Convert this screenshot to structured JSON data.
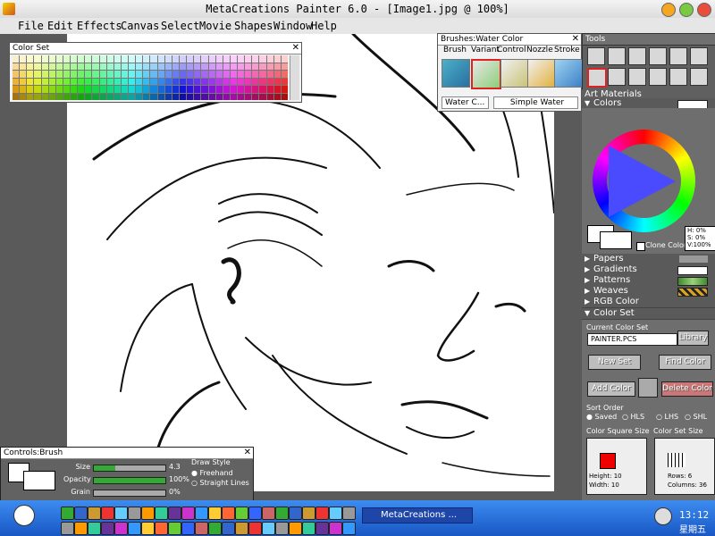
{
  "window": {
    "title": "MetaCreations Painter 6.0 - [Image1.jpg @ 100%]"
  },
  "menu": [
    "File",
    "Edit",
    "Effects",
    "Canvas",
    "Select",
    "Movie",
    "Shapes",
    "Window",
    "Help"
  ],
  "color_set_panel": {
    "title": "Color Set"
  },
  "brushes_panel": {
    "title": "Brushes:Water Color",
    "tabs": [
      "Brush",
      "Variant",
      "Control",
      "Nozzle",
      "Stroke"
    ],
    "category": "Water C...",
    "variant": "Simple Water"
  },
  "tools_panel": {
    "title": "Tools"
  },
  "art_materials": {
    "title": "Art Materials",
    "sections": [
      "Colors",
      "Papers",
      "Gradients",
      "Patterns",
      "Weaves",
      "RGB Color",
      "Color Set"
    ],
    "hsv": {
      "h": "H:  0%",
      "s": "S:  0%",
      "v": "V:100%"
    },
    "clone_color": "Clone Color",
    "current_color_set_label": "Current Color Set",
    "current_color_set_value": "PAINTER.PCS",
    "buttons": {
      "library": "Library",
      "new_set": "New Set",
      "find_color": "Find Color",
      "add_color": "Add Color",
      "delete_color": "Delete Color"
    },
    "sort_order_label": "Sort Order",
    "sort_options": [
      "Saved",
      "HLS",
      "LHS",
      "SHL"
    ],
    "color_square_size": {
      "label": "Color Square Size",
      "height": "Height: 10",
      "width": "Width: 10"
    },
    "color_set_size": {
      "label": "Color Set Size",
      "rows": "Rows: 6",
      "columns": "Columns: 36"
    }
  },
  "controls_panel": {
    "title": "Controls:Brush",
    "sliders": [
      {
        "label": "Size",
        "value": "4.3",
        "level": 0.3
      },
      {
        "label": "Opacity",
        "value": "100%",
        "level": 1.0
      },
      {
        "label": "Grain",
        "value": "0%",
        "level": 0.0
      }
    ],
    "draw_style": {
      "label": "Draw Style",
      "options": [
        "Freehand",
        "Straight Lines"
      ],
      "selected": "Freehand"
    }
  },
  "taskbar": {
    "task": "MetaCreations ...",
    "time": "13:12",
    "weekday": "星期五"
  }
}
